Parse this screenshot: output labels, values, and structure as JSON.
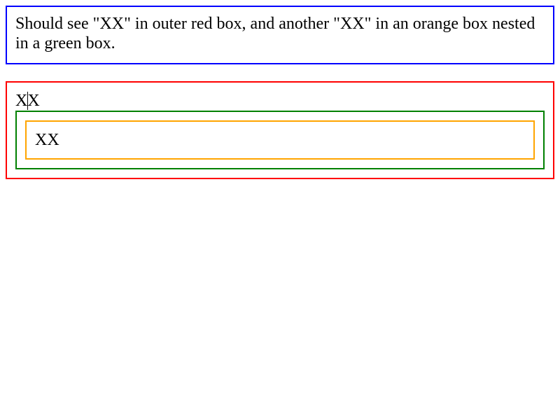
{
  "description": {
    "text": "Should see \"XX\" in outer red box, and another \"XX\" in an orange box nested in a green box."
  },
  "outer_box": {
    "text_first": "X",
    "text_second": "X"
  },
  "inner_box": {
    "text": "XX"
  },
  "colors": {
    "description_border": "#0000ff",
    "outer_border": "#ff0000",
    "middle_border": "#008000",
    "inner_border": "#ffa500"
  }
}
